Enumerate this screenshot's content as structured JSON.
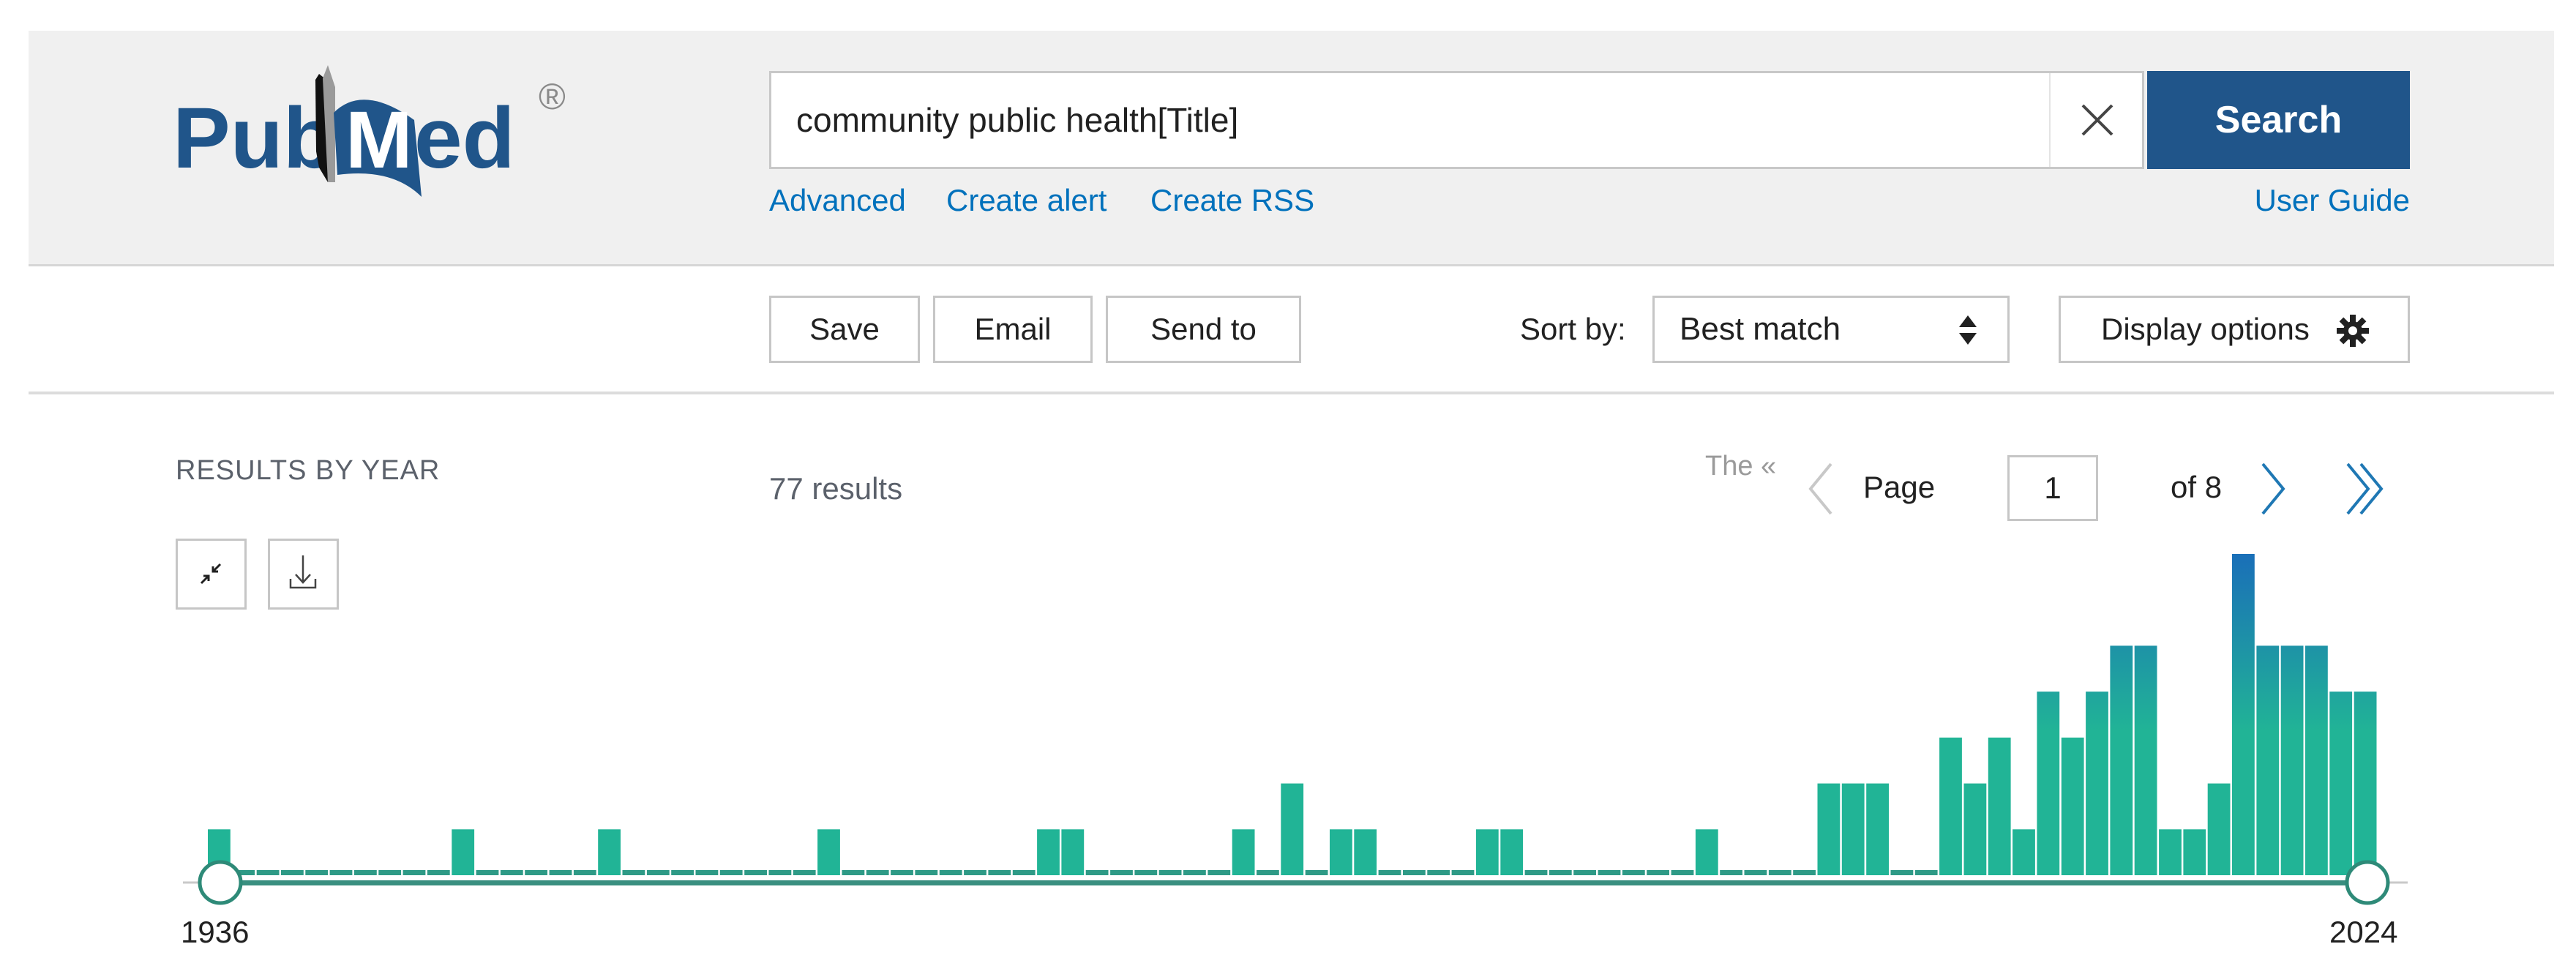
{
  "header": {
    "logo_text_left": "Pub",
    "logo_text_right": "Med",
    "logo_mark": "®",
    "search": {
      "value": "community public health[Title]",
      "clear_icon": "close-icon",
      "button_label": "Search"
    },
    "links": {
      "advanced": "Advanced",
      "create_alert": "Create alert",
      "create_rss": "Create RSS",
      "user_guide": "User Guide"
    }
  },
  "toolbar": {
    "save_label": "Save",
    "email_label": "Email",
    "send_to_label": "Send to",
    "sort_by_label": "Sort by:",
    "sort_selected": "Best match",
    "sort_icon": "sort-arrows-icon",
    "display_options_label": "Display options",
    "display_options_icon": "gear-icon"
  },
  "results": {
    "section_title": "RESULTS BY YEAR",
    "count_text": "77 results",
    "collapse_icon": "collapse-icon",
    "download_icon": "download-icon"
  },
  "pagination": {
    "first_label": "The «",
    "prev_icon": "chevron-left-icon",
    "page_label": "Page",
    "current_page": "1",
    "of_text": "of 8",
    "next_icon": "chevron-right-icon",
    "last_icon": "double-chevron-right-icon"
  },
  "colors": {
    "brand_blue": "#20558a",
    "link_blue": "#0071bc",
    "bar_teal": "#21b496",
    "bar_blue": "#1a6fb8",
    "axis": "#3a8f80"
  },
  "chart_data": {
    "type": "bar",
    "title": "RESULTS BY YEAR",
    "xlabel": "",
    "ylabel": "",
    "x_range": [
      1936,
      2024
    ],
    "range_labels": [
      "1936",
      "2024"
    ],
    "ylim": [
      0,
      7
    ],
    "grid": false,
    "legend": "none",
    "years": [
      1936,
      1937,
      1938,
      1939,
      1940,
      1941,
      1942,
      1943,
      1944,
      1945,
      1946,
      1947,
      1948,
      1949,
      1950,
      1951,
      1952,
      1953,
      1954,
      1955,
      1956,
      1957,
      1958,
      1959,
      1960,
      1961,
      1962,
      1963,
      1964,
      1965,
      1966,
      1967,
      1968,
      1969,
      1970,
      1971,
      1972,
      1973,
      1974,
      1975,
      1976,
      1977,
      1978,
      1979,
      1980,
      1981,
      1982,
      1983,
      1984,
      1985,
      1986,
      1987,
      1988,
      1989,
      1990,
      1991,
      1992,
      1993,
      1994,
      1995,
      1996,
      1997,
      1998,
      1999,
      2000,
      2001,
      2002,
      2003,
      2004,
      2005,
      2006,
      2007,
      2008,
      2009,
      2010,
      2011,
      2012,
      2013,
      2014,
      2015,
      2016,
      2017,
      2018,
      2019,
      2020,
      2021,
      2022,
      2023,
      2024
    ],
    "values": [
      1,
      0,
      0,
      0,
      0,
      0,
      0,
      0,
      0,
      0,
      1,
      0,
      0,
      0,
      0,
      0,
      1,
      0,
      0,
      0,
      0,
      0,
      0,
      0,
      0,
      1,
      0,
      0,
      0,
      0,
      0,
      0,
      0,
      0,
      1,
      1,
      0,
      0,
      0,
      0,
      0,
      0,
      1,
      0,
      2,
      0,
      1,
      1,
      0,
      0,
      0,
      0,
      1,
      1,
      0,
      0,
      0,
      0,
      0,
      0,
      0,
      1,
      0,
      0,
      0,
      0,
      2,
      2,
      2,
      0,
      0,
      3,
      2,
      3,
      1,
      4,
      3,
      4,
      5,
      5,
      1,
      1,
      2,
      7,
      5,
      5,
      5,
      4,
      4
    ]
  }
}
